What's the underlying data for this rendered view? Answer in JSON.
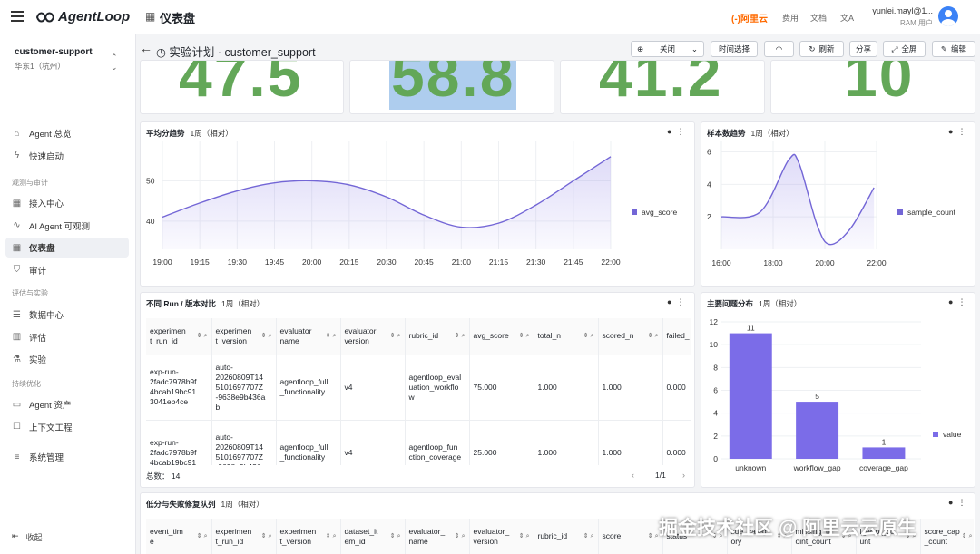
{
  "topbar": {
    "logo": "AgentLoop",
    "page_title": "仪表盘",
    "aliyun": "阿里云",
    "links": [
      "费用",
      "文档"
    ],
    "user_name": "yunlei.mayl@1...",
    "user_role": "RAM 用户"
  },
  "workspace": {
    "name": "customer-support",
    "region": "华东1（杭州）"
  },
  "nav": {
    "items": [
      {
        "label": "Agent 总览",
        "icon": "home-icon"
      },
      {
        "label": "快速启动",
        "icon": "bolt-icon"
      }
    ],
    "sec1": "观测与审计",
    "items1": [
      {
        "label": "接入中心",
        "icon": "grid-icon"
      },
      {
        "label": "AI Agent 可观测",
        "icon": "wave-icon"
      },
      {
        "label": "仪表盘",
        "icon": "dashboard-icon"
      },
      {
        "label": "审计",
        "icon": "shield-icon"
      }
    ],
    "sec2": "评估与实验",
    "items2": [
      {
        "label": "数据中心",
        "icon": "database-icon"
      },
      {
        "label": "评估",
        "icon": "chart-icon"
      },
      {
        "label": "实验",
        "icon": "flask-icon"
      }
    ],
    "sec3": "持续优化",
    "items3": [
      {
        "label": "Agent 资产",
        "icon": "folder-icon"
      },
      {
        "label": "上下文工程",
        "icon": "book-icon"
      }
    ],
    "items4": [
      {
        "label": "系统管理",
        "icon": "sliders-icon"
      }
    ],
    "collapse": "收起"
  },
  "header": {
    "title": "实验计划 · customer_support",
    "select": "关闭",
    "time_btn": "时间选择",
    "refresh": "刷新",
    "share": "分享",
    "fullscreen": "全屏",
    "edit": "编辑"
  },
  "stats": [
    "47.5",
    "58.8",
    "41.2",
    "10"
  ],
  "avg_chart": {
    "title": "平均分趋势",
    "range": "1周（相对）",
    "legend": "avg_score"
  },
  "sample_chart": {
    "title": "样本数趋势",
    "range": "1周（相对）",
    "legend": "sample_count"
  },
  "run_table": {
    "title": "不同 Run / 版本对比",
    "range": "1周（相对）",
    "headers": [
      [
        "experimen",
        "t_run_id"
      ],
      [
        "experimen",
        "t_version"
      ],
      [
        "evaluator_",
        "name"
      ],
      [
        "evaluator_",
        "version"
      ],
      [
        "rubric_id",
        ""
      ],
      [
        "avg_score",
        ""
      ],
      [
        "total_n",
        ""
      ],
      [
        "scored_n",
        ""
      ],
      [
        "failed_",
        ""
      ]
    ],
    "rows": [
      [
        "exp-run-\n2fadc7978b9f\n4bcab19bc91\n3041eb4ce",
        "auto-\n20260809T14\n5101697707Z\n-9638e9b436a\nb",
        "agentloop_full\n_functionality",
        "v4",
        "agentloop_eval\nuation_workflo\nw",
        "75.000",
        "1.000",
        "1.000",
        "0.000"
      ],
      [
        "exp-run-\n2fadc7978b9f\n4bcab19bc91",
        "auto-\n20260809T14\n5101697707Z\n-9638e9b436a",
        "agentloop_full\n_functionality",
        "v4",
        "agentloop_fun\nction_coverage",
        "25.000",
        "1.000",
        "1.000",
        "0.000"
      ]
    ],
    "total": "总数： 14",
    "page": "1/1"
  },
  "issue_chart": {
    "title": "主要问题分布",
    "range": "1周（相对）",
    "legend": "value"
  },
  "queue_table": {
    "title": "低分与失败修复队列",
    "range": "1周（相对）",
    "headers": [
      [
        "event_tim",
        "e"
      ],
      [
        "experimen",
        "t_run_id"
      ],
      [
        "experimen",
        "t_version"
      ],
      [
        "dataset_it",
        "em_id"
      ],
      [
        "evaluator_",
        "name"
      ],
      [
        "evaluator_",
        "version"
      ],
      [
        "rubric_id",
        ""
      ],
      [
        "score",
        ""
      ],
      [
        "status",
        ""
      ],
      [
        "sue_categ",
        "ory"
      ],
      [
        "missing_p",
        "oint_count"
      ],
      [
        "l_error_co",
        "unt"
      ],
      [
        "score_cap",
        "_count"
      ]
    ]
  },
  "watermark": "掘金技术社区 @ 阿里云云原生",
  "chart_data": [
    {
      "type": "area",
      "title": "平均分趋势",
      "x": [
        "19:00",
        "19:15",
        "19:30",
        "19:45",
        "20:00",
        "20:15",
        "20:30",
        "20:45",
        "21:00",
        "21:15",
        "21:30",
        "21:45",
        "22:00"
      ],
      "series": [
        {
          "name": "avg_score",
          "values": [
            41,
            44.5,
            47.5,
            49.5,
            50,
            49,
            46,
            41.5,
            38.5,
            39.5,
            44,
            50,
            56
          ]
        }
      ],
      "ylim": [
        33,
        60
      ],
      "yticks": [
        40,
        50
      ],
      "legend": "right"
    },
    {
      "type": "area",
      "title": "样本数趋势",
      "x": [
        "16:00",
        "18:00",
        "20:00",
        "22:00"
      ],
      "series": [
        {
          "name": "sample_count",
          "points": [
            [
              16,
              2
            ],
            [
              17.5,
              2.3
            ],
            [
              18.6,
              5.5
            ],
            [
              19,
              5.3
            ],
            [
              19.7,
              1.5
            ],
            [
              20.2,
              0.3
            ],
            [
              21,
              1.3
            ],
            [
              21.9,
              3.8
            ]
          ]
        }
      ],
      "ylim": [
        0,
        6.7
      ],
      "yticks": [
        2,
        4,
        6
      ],
      "legend": "right"
    },
    {
      "type": "bar",
      "title": "主要问题分布",
      "categories": [
        "unknown",
        "workflow_gap",
        "coverage_gap"
      ],
      "series": [
        {
          "name": "value",
          "values": [
            11,
            5,
            1
          ]
        }
      ],
      "ylim": [
        0,
        12
      ],
      "yticks": [
        0,
        2,
        4,
        6,
        8,
        10,
        12
      ],
      "legend": "right"
    }
  ]
}
